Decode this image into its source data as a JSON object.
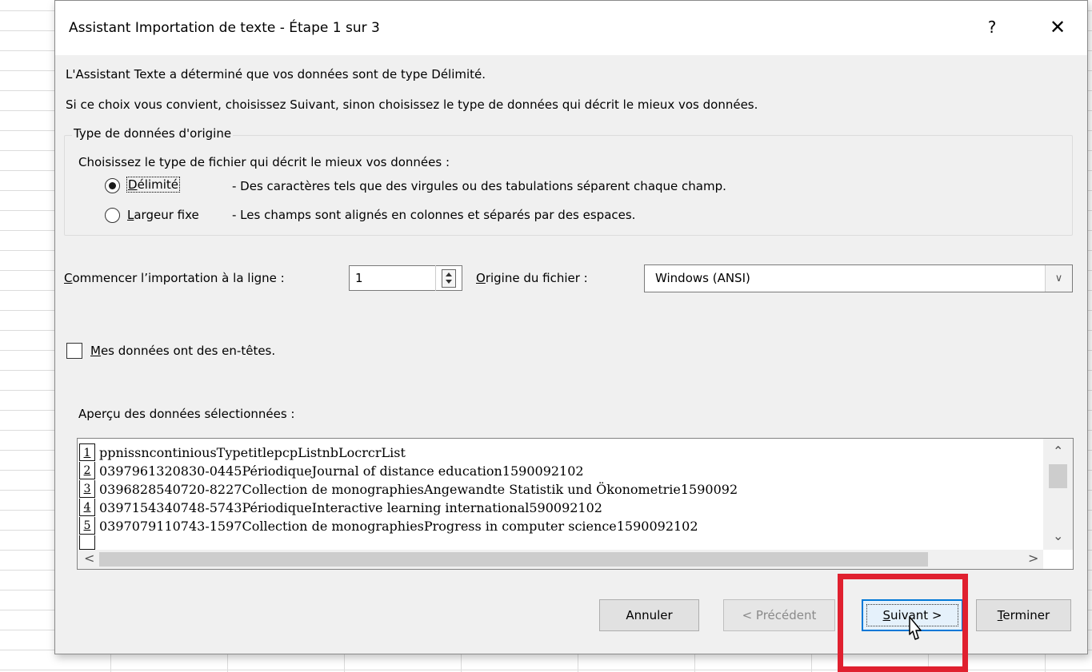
{
  "dialog": {
    "title": "Assistant Importation de texte - Étape 1 sur 3",
    "help_label": "?",
    "close_label": "✕"
  },
  "intro": {
    "line1": "L'Assistant Texte a déterminé que vos données sont de type Délimité.",
    "line2": "Si ce choix vous convient, choisissez Suivant, sinon choisissez le type de données qui décrit le mieux vos données."
  },
  "group": {
    "title": "Type de données d'origine",
    "prompt": "Choisissez le type de fichier qui décrit le mieux vos données :",
    "options": [
      {
        "accel": "D",
        "label_rest": "élimité",
        "description": "- Des caractères tels que des virgules ou des tabulations séparent chaque champ.",
        "checked": true
      },
      {
        "accel": "L",
        "label_rest": "argeur fixe",
        "description": "- Les champs sont alignés en colonnes et séparés par des espaces.",
        "checked": false
      }
    ]
  },
  "start_row": {
    "accel": "C",
    "label_rest": "ommencer l’importation à la ligne :",
    "value": "1"
  },
  "file_origin": {
    "accel": "O",
    "label_rest": "rigine du fichier :",
    "value": "Windows (ANSI)"
  },
  "headers_checkbox": {
    "accel": "M",
    "label_rest": "es données ont des en-têtes.",
    "checked": false
  },
  "preview": {
    "label": "Aperçu des données sélectionnées :",
    "rows": [
      {
        "num": "1",
        "text": "ppnissncontiniousTypetitlepcpListnbLocrcrList"
      },
      {
        "num": "2",
        "text": "0397961320830-0445PériodiqueJournal of distance education1590092102"
      },
      {
        "num": "3",
        "text": "0396828540720-8227Collection de monographiesAngewandte Statistik und Ökonometrie1590092"
      },
      {
        "num": "4",
        "text": "0397154340748-5743PériodiqueInteractive learning international590092102"
      },
      {
        "num": "5",
        "text": "0397079110743-1597Collection de monographiesProgress in computer science1590092102"
      }
    ]
  },
  "buttons": {
    "cancel": "Annuler",
    "previous": "< Précédent",
    "next_accel": "S",
    "next_rest": "uivant >",
    "finish_accel": "T",
    "finish_rest": "erminer"
  },
  "colors": {
    "highlight": "#e0202f",
    "focus": "#0078d7"
  }
}
